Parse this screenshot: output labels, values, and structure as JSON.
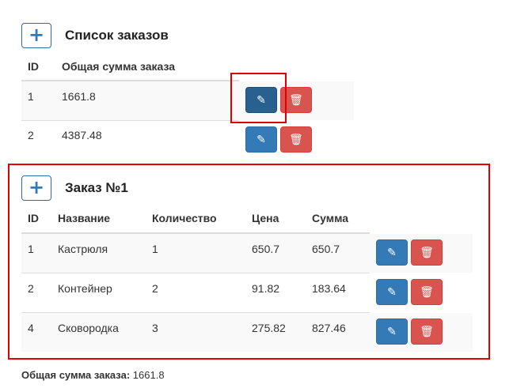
{
  "orders": {
    "add_icon": "plus-icon",
    "title": "Список заказов",
    "columns": [
      "ID",
      "Общая сумма заказа"
    ],
    "rows": [
      {
        "id": "1",
        "total": "1661.8"
      },
      {
        "id": "2",
        "total": "4387.48"
      }
    ]
  },
  "order": {
    "add_icon": "plus-icon",
    "title": "Заказ №1",
    "columns": [
      "ID",
      "Название",
      "Количество",
      "Цена",
      "Сумма"
    ],
    "rows": [
      {
        "id": "1",
        "name": "Кастрюля",
        "qty": "1",
        "price": "650.7",
        "sum": "650.7"
      },
      {
        "id": "2",
        "name": "Контейнер",
        "qty": "2",
        "price": "91.82",
        "sum": "183.64"
      },
      {
        "id": "4",
        "name": "Сковородка",
        "qty": "3",
        "price": "275.82",
        "sum": "827.46"
      }
    ]
  },
  "footer": {
    "total_label": "Общая сумма заказа:",
    "total_value": "1661.8"
  },
  "icons": {
    "edit": "pencil-icon",
    "delete": "trash-icon"
  },
  "colors": {
    "primary": "#337ab7",
    "danger": "#d9534f",
    "highlight": "#e00000"
  }
}
